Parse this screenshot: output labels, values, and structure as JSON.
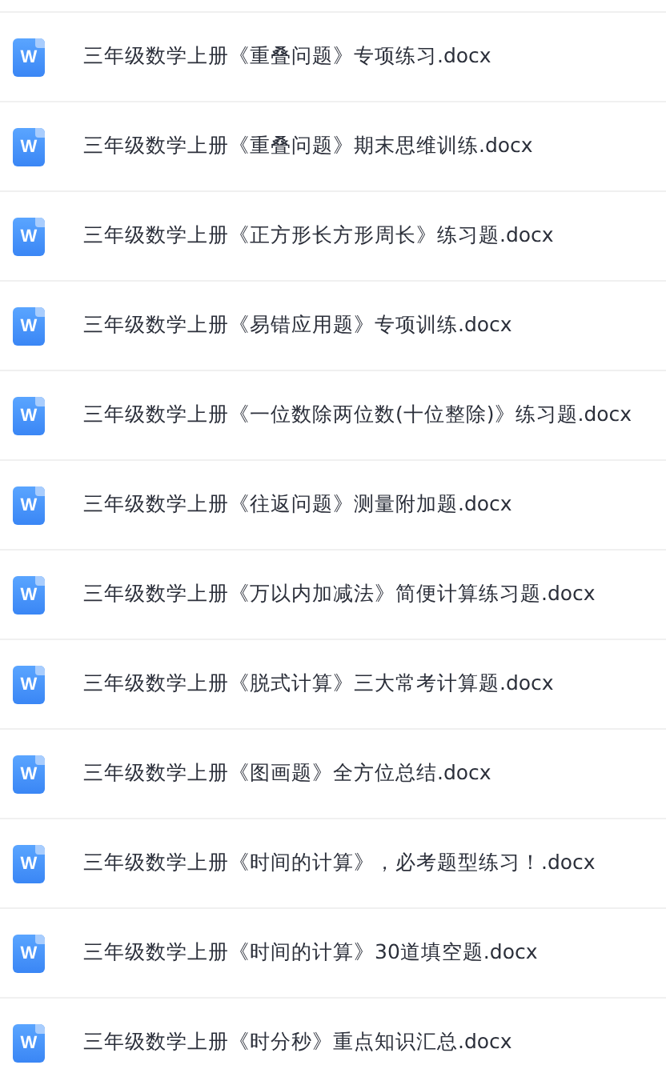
{
  "files": [
    {
      "icon_label": "W",
      "name": "三年级数学上册《重叠问题》专项练习.docx"
    },
    {
      "icon_label": "W",
      "name": "三年级数学上册《重叠问题》期末思维训练.docx"
    },
    {
      "icon_label": "W",
      "name": "三年级数学上册《正方形长方形周长》练习题.docx"
    },
    {
      "icon_label": "W",
      "name": "三年级数学上册《易错应用题》专项训练.docx"
    },
    {
      "icon_label": "W",
      "name": "三年级数学上册《一位数除两位数(十位整除)》练习题.docx"
    },
    {
      "icon_label": "W",
      "name": "三年级数学上册《往返问题》测量附加题.docx"
    },
    {
      "icon_label": "W",
      "name": "三年级数学上册《万以内加减法》简便计算练习题.docx"
    },
    {
      "icon_label": "W",
      "name": "三年级数学上册《脱式计算》三大常考计算题.docx"
    },
    {
      "icon_label": "W",
      "name": "三年级数学上册《图画题》全方位总结.docx"
    },
    {
      "icon_label": "W",
      "name": "三年级数学上册《时间的计算》，必考题型练习！.docx"
    },
    {
      "icon_label": "W",
      "name": "三年级数学上册《时间的计算》30道填空题.docx"
    },
    {
      "icon_label": "W",
      "name": "三年级数学上册《时分秒》重点知识汇总.docx"
    }
  ]
}
